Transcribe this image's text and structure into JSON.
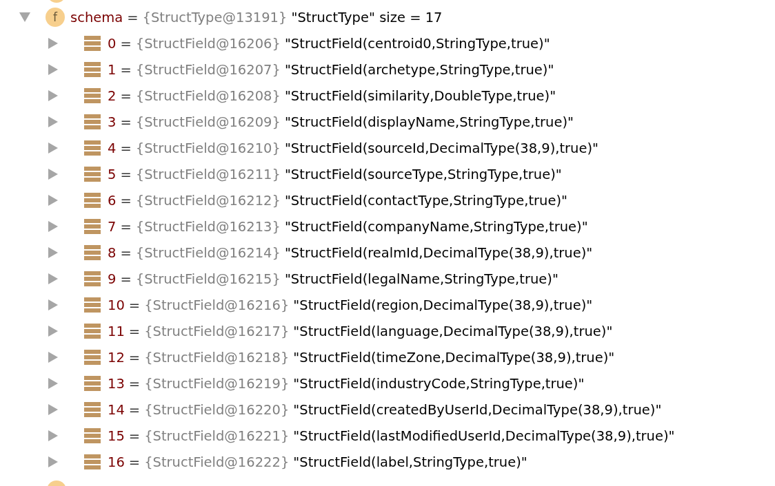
{
  "tree": [
    {
      "kind": "field",
      "badge": "f",
      "expanded": true,
      "name": "schema",
      "sep": "=",
      "ref": "{StructType@13191}",
      "value": "\"StructType\" size = 17",
      "children": [
        {
          "kind": "element",
          "expanded": false,
          "name": "0",
          "sep": "=",
          "ref": "{StructField@16206}",
          "value": "\"StructField(centroid0,StringType,true)\""
        },
        {
          "kind": "element",
          "expanded": false,
          "name": "1",
          "sep": "=",
          "ref": "{StructField@16207}",
          "value": "\"StructField(archetype,StringType,true)\""
        },
        {
          "kind": "element",
          "expanded": false,
          "name": "2",
          "sep": "=",
          "ref": "{StructField@16208}",
          "value": "\"StructField(similarity,DoubleType,true)\""
        },
        {
          "kind": "element",
          "expanded": false,
          "name": "3",
          "sep": "=",
          "ref": "{StructField@16209}",
          "value": "\"StructField(displayName,StringType,true)\""
        },
        {
          "kind": "element",
          "expanded": false,
          "name": "4",
          "sep": "=",
          "ref": "{StructField@16210}",
          "value": "\"StructField(sourceId,DecimalType(38,9),true)\""
        },
        {
          "kind": "element",
          "expanded": false,
          "name": "5",
          "sep": "=",
          "ref": "{StructField@16211}",
          "value": "\"StructField(sourceType,StringType,true)\""
        },
        {
          "kind": "element",
          "expanded": false,
          "name": "6",
          "sep": "=",
          "ref": "{StructField@16212}",
          "value": "\"StructField(contactType,StringType,true)\""
        },
        {
          "kind": "element",
          "expanded": false,
          "name": "7",
          "sep": "=",
          "ref": "{StructField@16213}",
          "value": "\"StructField(companyName,StringType,true)\""
        },
        {
          "kind": "element",
          "expanded": false,
          "name": "8",
          "sep": "=",
          "ref": "{StructField@16214}",
          "value": "\"StructField(realmId,DecimalType(38,9),true)\""
        },
        {
          "kind": "element",
          "expanded": false,
          "name": "9",
          "sep": "=",
          "ref": "{StructField@16215}",
          "value": "\"StructField(legalName,StringType,true)\""
        },
        {
          "kind": "element",
          "expanded": false,
          "name": "10",
          "sep": "=",
          "ref": "{StructField@16216}",
          "value": "\"StructField(region,DecimalType(38,9),true)\""
        },
        {
          "kind": "element",
          "expanded": false,
          "name": "11",
          "sep": "=",
          "ref": "{StructField@16217}",
          "value": "\"StructField(language,DecimalType(38,9),true)\""
        },
        {
          "kind": "element",
          "expanded": false,
          "name": "12",
          "sep": "=",
          "ref": "{StructField@16218}",
          "value": "\"StructField(timeZone,DecimalType(38,9),true)\""
        },
        {
          "kind": "element",
          "expanded": false,
          "name": "13",
          "sep": "=",
          "ref": "{StructField@16219}",
          "value": "\"StructField(industryCode,StringType,true)\""
        },
        {
          "kind": "element",
          "expanded": false,
          "name": "14",
          "sep": "=",
          "ref": "{StructField@16220}",
          "value": "\"StructField(createdByUserId,DecimalType(38,9),true)\""
        },
        {
          "kind": "element",
          "expanded": false,
          "name": "15",
          "sep": "=",
          "ref": "{StructField@16221}",
          "value": "\"StructField(lastModifiedUserId,DecimalType(38,9),true)\""
        },
        {
          "kind": "element",
          "expanded": false,
          "name": "16",
          "sep": "=",
          "ref": "{StructField@16222}",
          "value": "\"StructField(label,StringType,true)\""
        }
      ]
    }
  ]
}
